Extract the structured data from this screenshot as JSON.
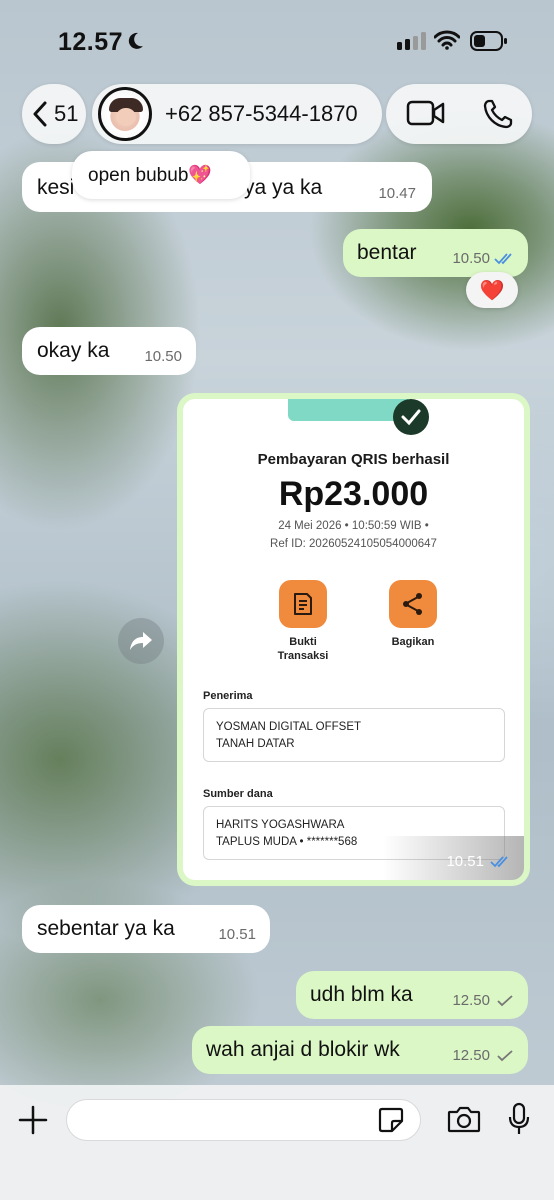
{
  "status_bar": {
    "time": "12.57"
  },
  "header": {
    "back_count": "51",
    "contact_name": "+62 857-5344-1870"
  },
  "status_tag": {
    "text": "open bubub💖"
  },
  "messages": [
    {
      "text": "kesi",
      "text_tail": "ya ya ka",
      "time": "10.47",
      "direction": "in"
    },
    {
      "text": "bentar",
      "time": "10.50",
      "direction": "out",
      "reaction": "❤️"
    },
    {
      "text": "okay ka",
      "time": "10.50",
      "direction": "in"
    },
    {
      "text": "sebentar ya ka",
      "time": "10.51",
      "direction": "in"
    },
    {
      "text": "udh blm ka",
      "time": "12.50",
      "direction": "out"
    },
    {
      "text": "wah anjai d blokir wk",
      "time": "12.50",
      "direction": "out"
    }
  ],
  "receipt": {
    "title": "Pembayaran QRIS berhasil",
    "amount": "Rp23.000",
    "datetime": "24 Mei 2026 • 10:50:59 WIB •",
    "ref": "Ref ID: 20260524105054000647",
    "actions": [
      {
        "label_line1": "Bukti",
        "label_line2": "Transaksi",
        "icon": "document-icon"
      },
      {
        "label_line1": "Bagikan",
        "label_line2": "",
        "icon": "share-icon"
      }
    ],
    "recipient_label": "Penerima",
    "recipient_line1": "YOSMAN DIGITAL OFFSET",
    "recipient_line2": "TANAH DATAR",
    "source_label": "Sumber dana",
    "source_line1": "HARITS YOGASHWARA",
    "source_line2": "TAPLUS MUDA • *******568",
    "time": "10.51"
  },
  "input_bar": {
    "placeholder": ""
  },
  "colors": {
    "outgoing": "#dbf7c5",
    "incoming": "#ffffff",
    "read_ticks": "#4a8fe0",
    "action_orange": "#f08a3c"
  }
}
